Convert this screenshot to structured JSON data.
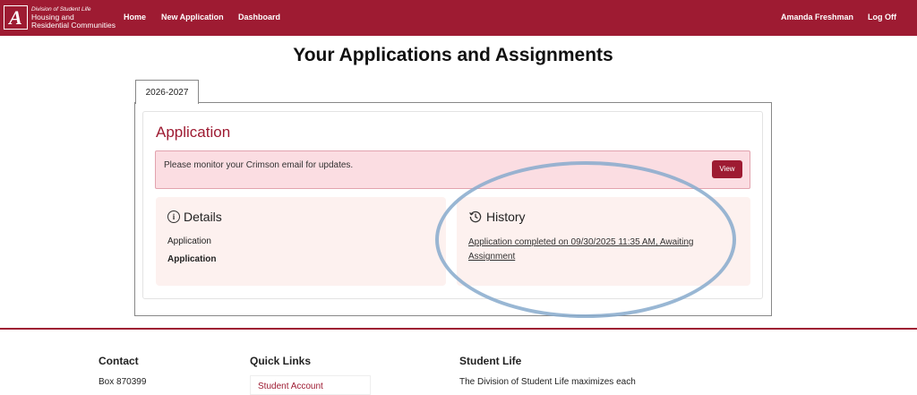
{
  "brand": {
    "logo_letter": "A",
    "line1": "Division of Student Life",
    "line2": "Housing and",
    "line3": "Residential Communities"
  },
  "nav": {
    "home": "Home",
    "new_application": "New Application",
    "dashboard": "Dashboard",
    "user": "Amanda Freshman",
    "logoff": "Log Off"
  },
  "page": {
    "title": "Your Applications and Assignments"
  },
  "tabs": [
    {
      "label": "2026-2027",
      "active": true
    }
  ],
  "application": {
    "title": "Application",
    "alert_text": "Please monitor your Crimson email for updates.",
    "view_label": "View",
    "details_title": "Details",
    "detail_label": "Application",
    "detail_value": "Application",
    "history_title": "History",
    "history_entry": "Application completed on 09/30/2025 11:35 AM, Awaiting Assignment"
  },
  "footer": {
    "contact_title": "Contact",
    "contact_line1": "Box 870399",
    "quick_links_title": "Quick Links",
    "quick_link1": "Student Account",
    "student_life_title": "Student Life",
    "student_life_text": "The Division of Student Life maximizes each"
  },
  "colors": {
    "brand_crimson": "#9e1b32",
    "alert_bg": "#fbdde2",
    "panel_bg": "#fdf1ef",
    "annotation": "#87aacd"
  },
  "icons": {
    "details": "info-circle-icon",
    "history": "history-clock-icon"
  }
}
